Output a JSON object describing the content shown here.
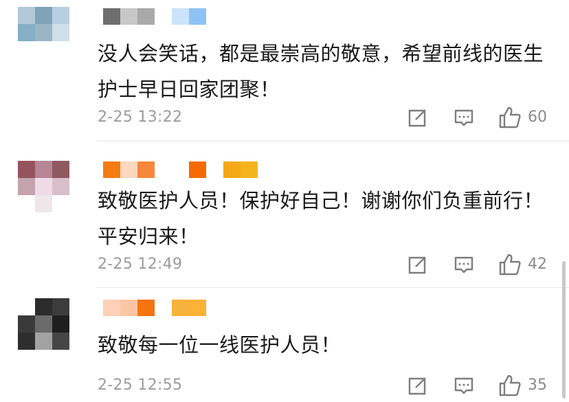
{
  "comments": [
    {
      "text": "没人会笑话，都是最崇高的敬意，希望前线的医生护士早日回家团聚！",
      "time": "2-25 13:22",
      "likes": "60",
      "avatar_colors": [
        "#b0c8d8",
        "#7fa4ba",
        "#b7cfe0",
        "#86aec6",
        "#9ab6c4",
        "#cfdfe8",
        "#ffffff",
        "#ffffff",
        "#ffffff"
      ],
      "name_colors": [
        "#6e6e6e",
        "#c8c8c8",
        "#a9a9a9",
        "#ffffff",
        "#cce4fb",
        "#8ec3f5"
      ]
    },
    {
      "text": "致敬医护人员！保护好自己！谢谢你们负重前行！平安归来！",
      "time": "2-25 12:49",
      "likes": "42",
      "avatar_colors": [
        "#93545e",
        "#b78696",
        "#8e5a5f",
        "#c4a3ac",
        "#efdbe6",
        "#d8bfca",
        "#ffffff",
        "#efe6ea",
        "#ffffff"
      ],
      "name_colors": [
        "#f57b12",
        "#fcd8bf",
        "#f7873c",
        "#ffffff",
        "#ffffff",
        "#f56a00",
        "#ffffff",
        "#f5a816",
        "#f5b31c"
      ]
    },
    {
      "text": "致敬每一位一线医护人员！",
      "time": "2-25 12:55",
      "likes": "35",
      "avatar_colors": [
        "#ffffff",
        "#2c2c2c",
        "#3d3d3d",
        "#3a3a3a",
        "#6b6b6b",
        "#1f1f1f",
        "#2e2e2e",
        "#a2a2a2",
        "#464646"
      ],
      "name_colors": [
        "#fdd1b8",
        "#fcc6a4",
        "#f57311",
        "#ffffff",
        "#f7b23c",
        "#fbb237"
      ]
    }
  ],
  "icons": {
    "repost": "repost-icon",
    "comment": "comment-icon",
    "like": "thumbs-up-icon"
  },
  "colors": {
    "text": "#1a1a1a",
    "meta": "#9b9b9b",
    "icon": "#7d7d7d",
    "divider": "#e5e5e5"
  }
}
